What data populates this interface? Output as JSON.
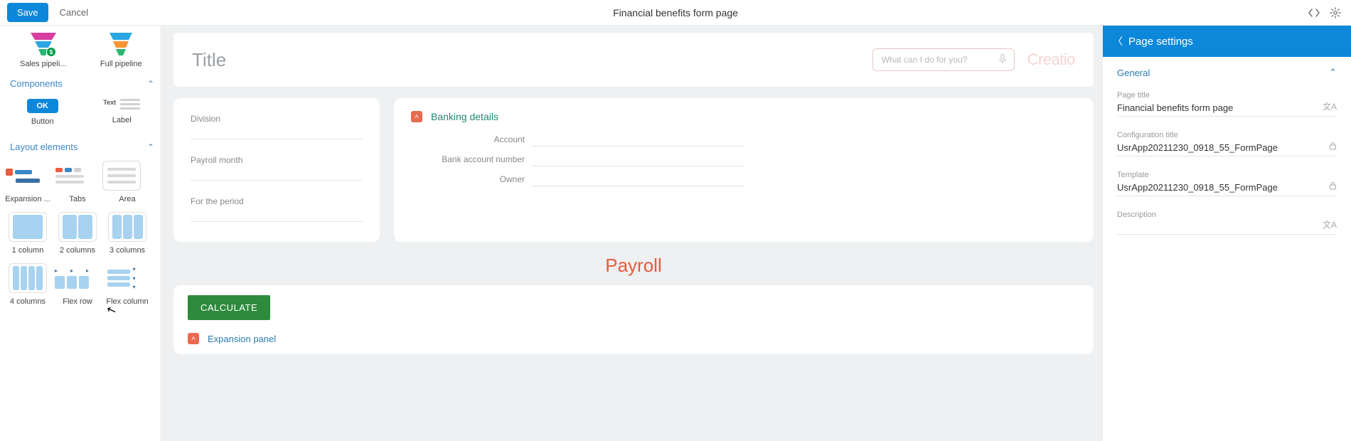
{
  "topbar": {
    "save": "Save",
    "cancel": "Cancel",
    "title": "Financial benefits form page"
  },
  "sidebar": {
    "widgets": [
      {
        "label": "Sales pipeli..."
      },
      {
        "label": "Full pipeline"
      }
    ],
    "components": {
      "title": "Components",
      "items": [
        {
          "label": "Button",
          "ok": "OK"
        },
        {
          "label": "Label",
          "text": "Text"
        }
      ]
    },
    "layout": {
      "title": "Layout elements",
      "items": [
        {
          "label": "Expansion ..."
        },
        {
          "label": "Tabs"
        },
        {
          "label": "Area"
        },
        {
          "label": "1 column"
        },
        {
          "label": "2 columns"
        },
        {
          "label": "3 columns"
        },
        {
          "label": "4 columns"
        },
        {
          "label": "Flex row"
        },
        {
          "label": "Flex column"
        }
      ]
    }
  },
  "canvas": {
    "title_placeholder": "Title",
    "search_placeholder": "What can I do for you?",
    "brand": "Creatio",
    "card1": {
      "f1": "Division",
      "f2": "Payroll month",
      "f3": "For the period"
    },
    "card2": {
      "title": "Banking details",
      "r1": "Account",
      "r2": "Bank account number",
      "r3": "Owner"
    },
    "payroll_heading": "Payroll",
    "calc": "CALCULATE",
    "exp2": "Expansion panel"
  },
  "rpanel": {
    "title": "Page settings",
    "section": "General",
    "page_title_label": "Page title",
    "page_title_value": "Financial benefits form page",
    "config_label": "Configuration title",
    "config_value": "UsrApp20211230_0918_55_FormPage",
    "template_label": "Template",
    "template_value": "UsrApp20211230_0918_55_FormPage",
    "desc_label": "Description",
    "desc_value": ""
  }
}
